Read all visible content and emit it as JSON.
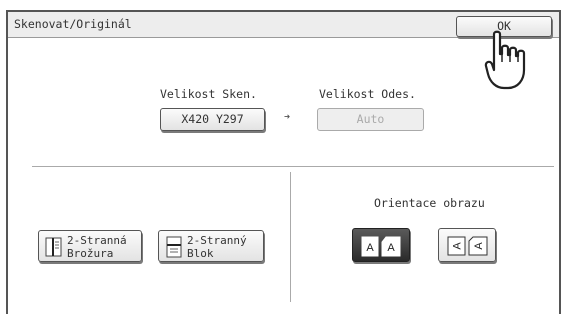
{
  "window": {
    "title": "Skenovat/Originál",
    "ok_label": "OK"
  },
  "scan_size": {
    "label": "Velikost Sken.",
    "value": "X420  Y297"
  },
  "send_size": {
    "label": "Velikost Odes.",
    "value": "Auto"
  },
  "binding": {
    "booklet": {
      "line1": "2-Stranná",
      "line2": "Brožura"
    },
    "tablet": {
      "line1": "2-Stranný",
      "line2": "Blok"
    }
  },
  "orientation": {
    "label": "Orientace obrazu",
    "selected": "portrait",
    "portrait_glyph": "A",
    "landscape_glyph": "A"
  },
  "colors": {
    "selected_bg": "#333333",
    "title_bg": "#ededed"
  }
}
